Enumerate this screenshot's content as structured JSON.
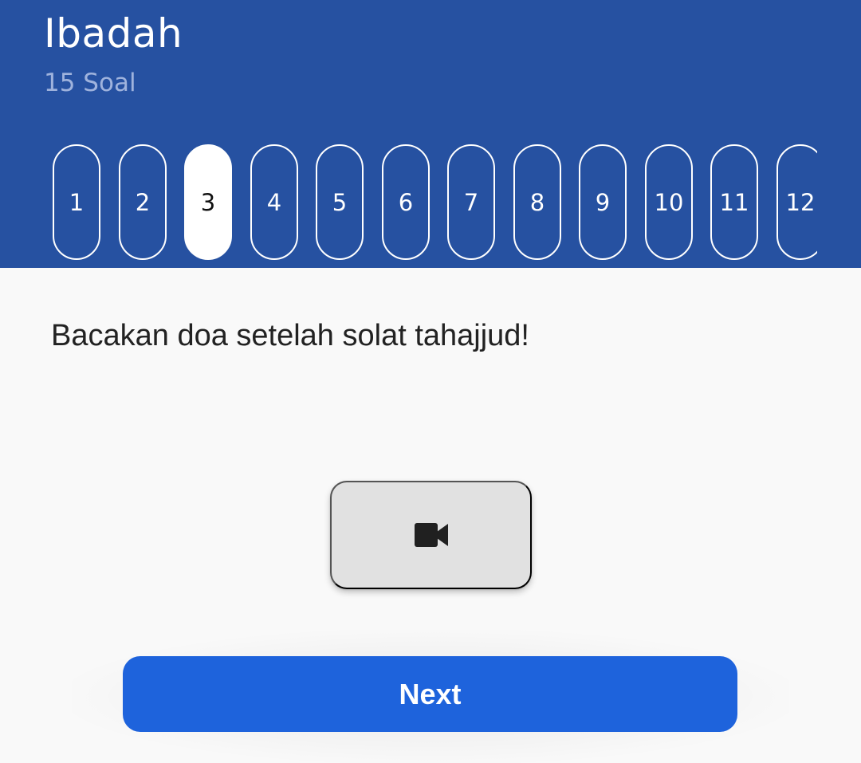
{
  "header": {
    "title": "Ibadah",
    "subtitle": "15 Soal"
  },
  "question_nav": {
    "active_number": "3",
    "items": [
      "1",
      "2",
      "3",
      "4",
      "5",
      "6",
      "7",
      "8",
      "9",
      "10",
      "11",
      "12"
    ]
  },
  "question": {
    "text": "Bacakan doa setelah solat tahajjud!"
  },
  "media": {
    "icon": "video-camera-icon"
  },
  "footer": {
    "next_label": "Next"
  },
  "colors": {
    "header_bg": "#2651a1",
    "active_pill_bg": "#ffffff",
    "next_button_bg": "#1e63dc",
    "video_button_bg": "#e1e1e1"
  }
}
